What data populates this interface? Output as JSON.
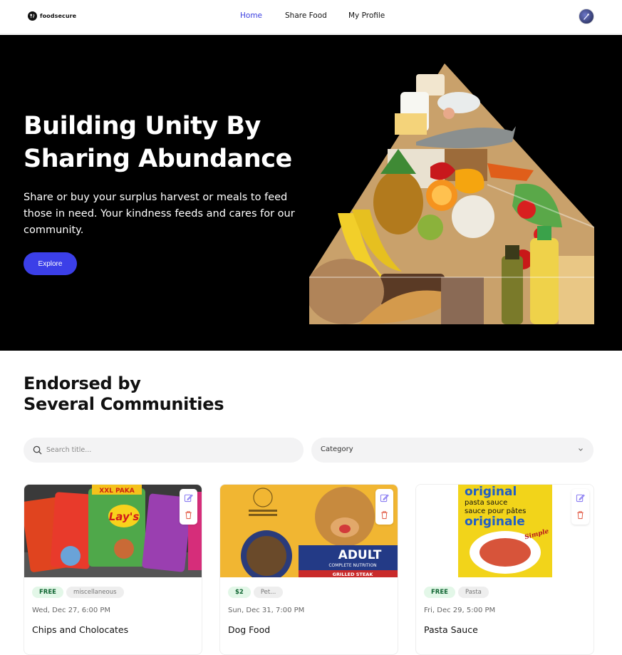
{
  "nav": {
    "brand": "foodsecure",
    "links": [
      {
        "label": "Home",
        "active": true
      },
      {
        "label": "Share Food",
        "active": false
      },
      {
        "label": "My Profile",
        "active": false
      }
    ]
  },
  "hero": {
    "title": "Building Unity By Sharing Abundance",
    "subtitle": "Share or buy your surplus harvest or meals to feed those in need. Your kindness feeds and cares for our community.",
    "cta": "Explore"
  },
  "section": {
    "title_line1": "Endorsed by",
    "title_line2": "Several Communities"
  },
  "filters": {
    "search_placeholder": "Search title...",
    "category_label": "Category"
  },
  "cards": [
    {
      "price": "FREE",
      "category": "miscellaneous",
      "date": "Wed, Dec 27, 6:00 PM",
      "title": "Chips and Cholocates"
    },
    {
      "price": "$2",
      "category": "Pet...",
      "date": "Sun, Dec 31, 7:00 PM",
      "title": "Dog Food"
    },
    {
      "price": "FREE",
      "category": "Pasta",
      "date": "Fri, Dec 29, 5:00 PM",
      "title": "Pasta Sauce"
    }
  ],
  "card_images": {
    "card1": {
      "brand_text": "Lay's",
      "banner": "XXL PAKA"
    },
    "card2": {
      "badge": "ADULT",
      "sub": "COMPLETE NUTRITION",
      "flavor": "GRILLED STEAK"
    },
    "card3": {
      "line1": "original",
      "line2": "pasta sauce",
      "line3": "sauce pour pâtes",
      "line4": "originale",
      "brand": "Simple"
    }
  },
  "colors": {
    "accent": "#3b3fe8",
    "hero_bg": "#000000",
    "free_tag_bg": "#e3f7e8"
  },
  "icons": [
    "brand-logo-icon",
    "avatar-icon",
    "search-icon",
    "chevron-down-icon",
    "edit-icon",
    "trash-icon"
  ]
}
